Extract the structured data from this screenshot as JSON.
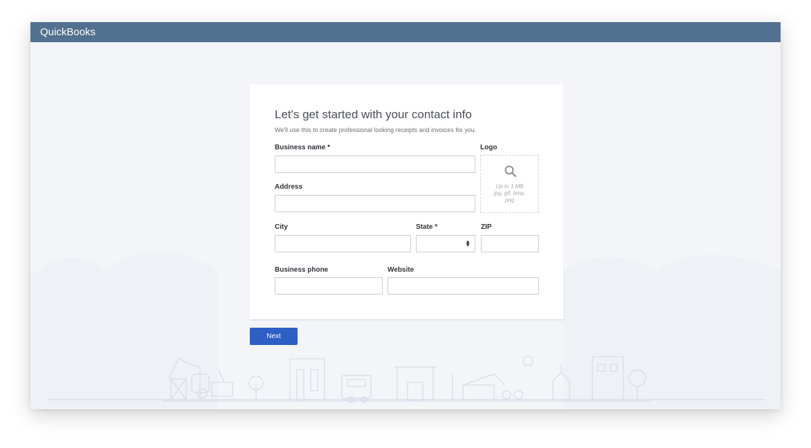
{
  "window": {
    "title": "QuickBooks"
  },
  "form": {
    "title": "Let's get started with your contact info",
    "subtitle": "We'll use this to create professional looking receipts and invoices for you.",
    "business_name_label": "Business name *",
    "address_label": "Address",
    "city_label": "City",
    "state_label": "State *",
    "zip_label": "ZIP",
    "phone_label": "Business phone",
    "website_label": "Website",
    "logo_label": "Logo",
    "logo_hint_line1": "Up to 1 MB",
    "logo_hint_line2": "jpg, gif, bmp,",
    "logo_hint_line3": "png",
    "business_name_value": "",
    "address_value": "",
    "city_value": "",
    "state_value": "",
    "zip_value": "",
    "phone_value": "",
    "website_value": ""
  },
  "actions": {
    "next_label": "Next"
  },
  "colors": {
    "titlebar": "#52708f",
    "primary_button": "#2d5fc4",
    "background": "#f3f5f9"
  },
  "icons": {
    "logo_upload": "search-icon",
    "state_select": "select-arrows-icon"
  }
}
